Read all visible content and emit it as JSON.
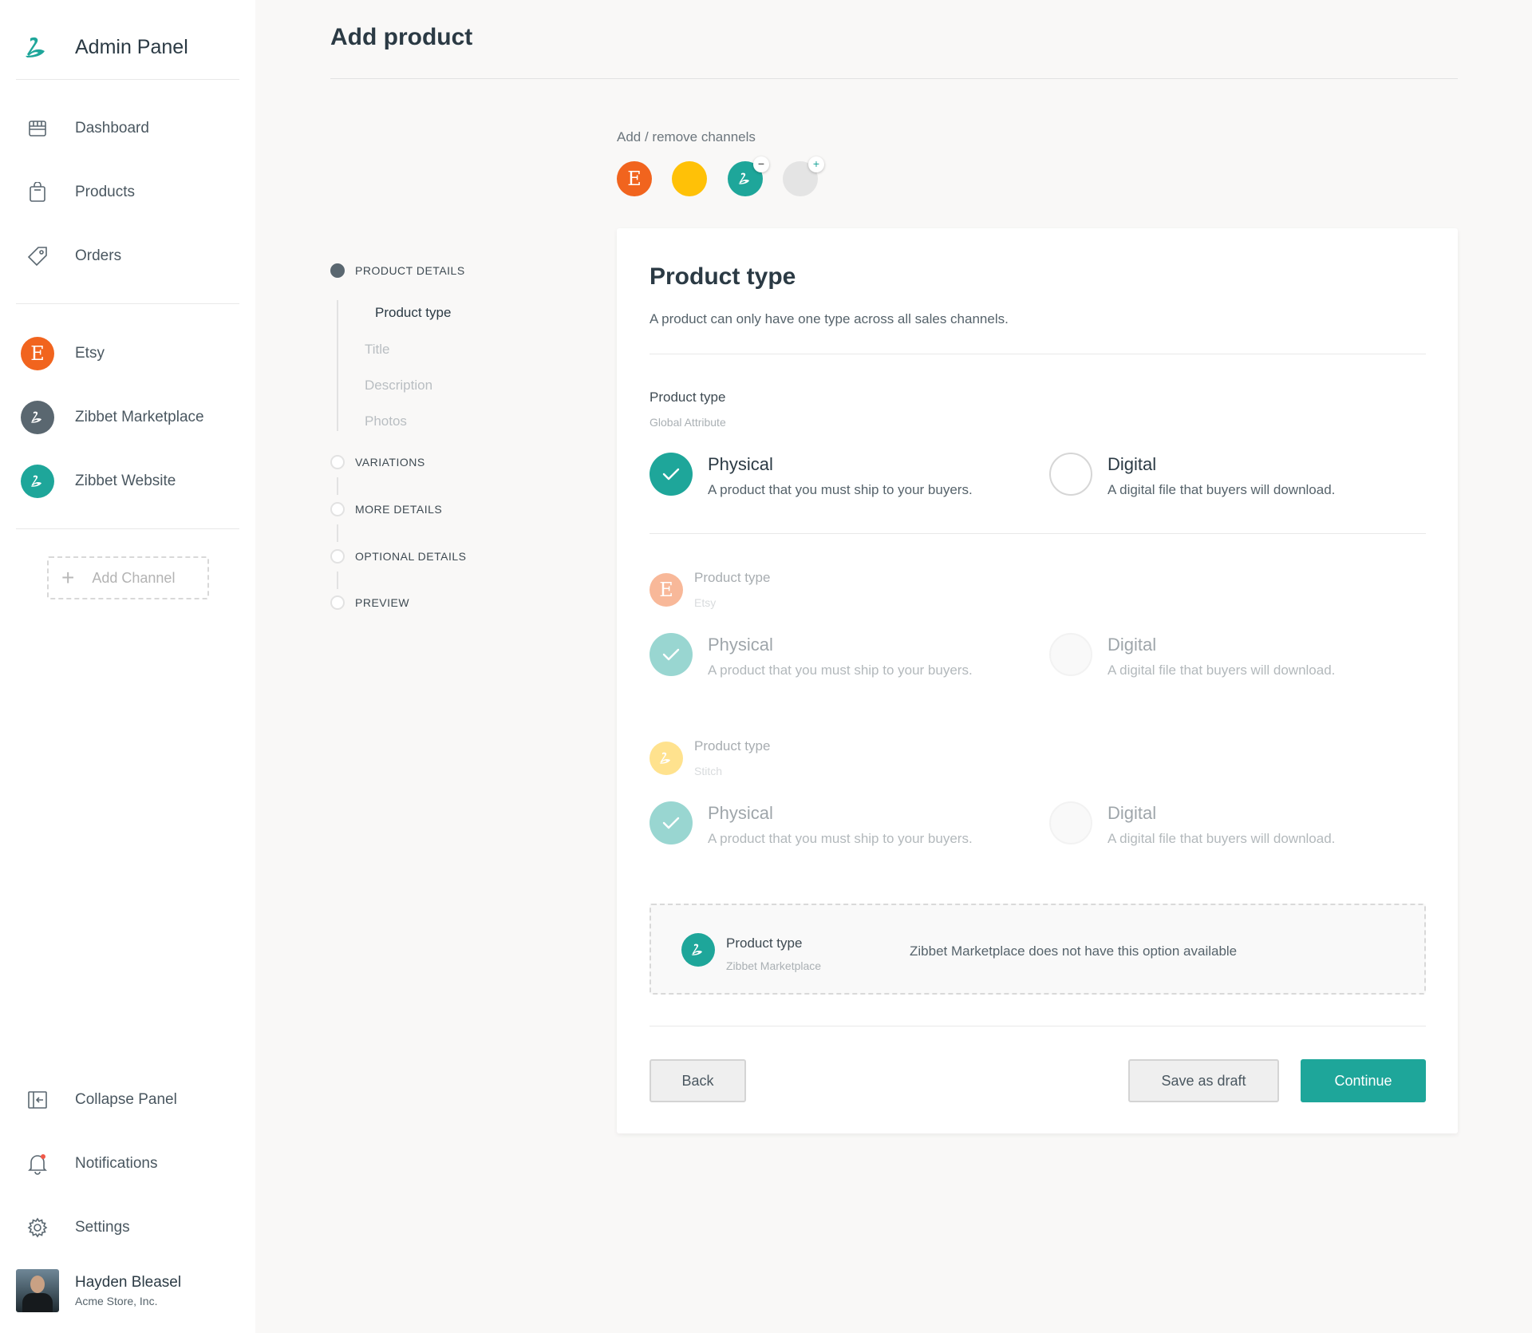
{
  "app": {
    "title": "Admin Panel"
  },
  "sidebar": {
    "nav": [
      {
        "label": "Dashboard",
        "icon": "store-icon"
      },
      {
        "label": "Products",
        "icon": "bag-icon"
      },
      {
        "label": "Orders",
        "icon": "tag-icon"
      }
    ],
    "channels": [
      {
        "label": "Etsy",
        "icon": "etsy-icon",
        "color": "#f1641e",
        "glyph": "E"
      },
      {
        "label": "Zibbet Marketplace",
        "icon": "zibbet-icon",
        "color": "#5a6770"
      },
      {
        "label": "Zibbet Website",
        "icon": "zibbet-icon",
        "color": "#1ea69a"
      }
    ],
    "add_channel": "Add Channel",
    "bottom": [
      {
        "label": "Collapse Panel",
        "icon": "collapse-icon"
      },
      {
        "label": "Notifications",
        "icon": "bell-icon"
      },
      {
        "label": "Settings",
        "icon": "gear-icon"
      }
    ],
    "user": {
      "name": "Hayden Bleasel",
      "org": "Acme Store, Inc."
    }
  },
  "page": {
    "title": "Add product"
  },
  "channels_picker": {
    "label": "Add / remove channels",
    "badges": {
      "remove": "−",
      "add": "+"
    }
  },
  "stepper": {
    "steps": [
      "PRODUCT DETAILS",
      "VARIATIONS",
      "MORE DETAILS",
      "OPTIONAL DETAILS",
      "PREVIEW"
    ],
    "substeps": [
      "Product type",
      "Title",
      "Description",
      "Photos"
    ],
    "current_step": 0,
    "current_substep": 0
  },
  "card": {
    "title": "Product type",
    "subtitle": "A product can only have one type across all sales channels.",
    "global": {
      "label": "Product type",
      "sub": "Global Attribute"
    },
    "etsy": {
      "label": "Product type",
      "sub": "Etsy",
      "glyph": "E"
    },
    "stitch": {
      "label": "Product type",
      "sub": "Stitch"
    },
    "options": {
      "physical": {
        "title": "Physical",
        "desc": "A product that you must ship to your buyers."
      },
      "digital": {
        "title": "Digital",
        "desc": "A digital file that buyers will download."
      }
    },
    "notice": {
      "label": "Product type",
      "sub": "Zibbet Marketplace",
      "message": "Zibbet Marketplace does not have this option available"
    },
    "buttons": {
      "back": "Back",
      "draft": "Save as draft",
      "continue": "Continue"
    }
  },
  "colors": {
    "accent": "#1ea69a",
    "etsy": "#f1641e",
    "stitch": "#ffc107",
    "marketplace": "#5a6770"
  }
}
